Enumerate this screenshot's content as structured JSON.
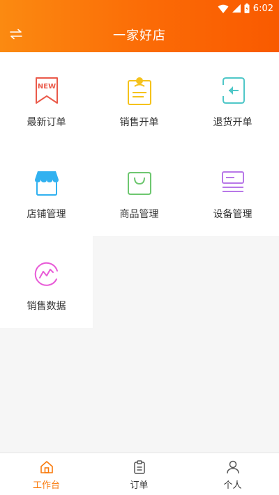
{
  "status_bar": {
    "time": "6:02"
  },
  "header": {
    "title": "一家好店",
    "switch_icon": "switch-arrows-icon"
  },
  "menu": [
    {
      "label": "最新订单",
      "icon": "new-order-icon",
      "badge": "NEW",
      "color": "#ea5a4a"
    },
    {
      "label": "销售开单",
      "icon": "sales-bill-icon",
      "color": "#f5c21b"
    },
    {
      "label": "退货开单",
      "icon": "return-bill-icon",
      "color": "#4fc7c8"
    },
    {
      "label": "店铺管理",
      "icon": "store-icon",
      "color": "#31b1f0"
    },
    {
      "label": "商品管理",
      "icon": "shopping-bag-icon",
      "color": "#6dc76f"
    },
    {
      "label": "设备管理",
      "icon": "device-icon",
      "color": "#b878e8"
    },
    {
      "label": "销售数据",
      "icon": "sales-chart-icon",
      "color": "#e85bd7"
    }
  ],
  "bottom_nav": [
    {
      "label": "工作台",
      "icon": "home-icon",
      "active": true
    },
    {
      "label": "订单",
      "icon": "order-clipboard-icon",
      "active": false
    },
    {
      "label": "个人",
      "icon": "person-icon",
      "active": false
    }
  ],
  "colors": {
    "brand_orange": "#fb6a06",
    "active_tab": "#f97a0b"
  }
}
